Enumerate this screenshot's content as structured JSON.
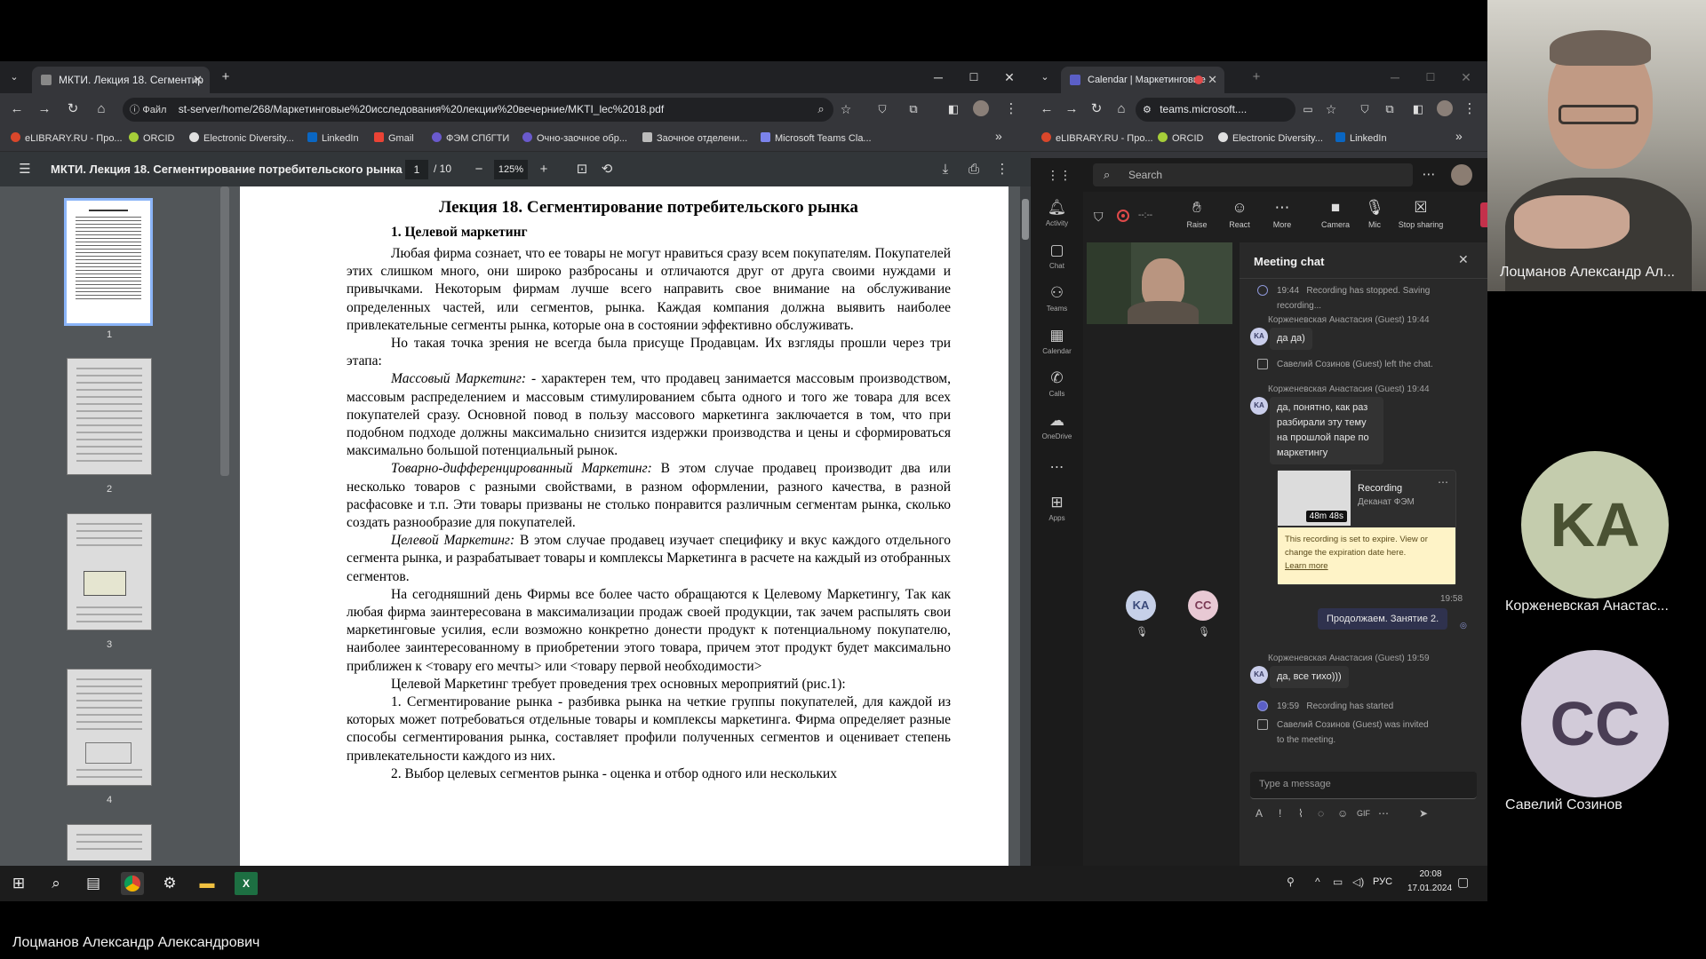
{
  "left_browser": {
    "tab_title": "МКТИ. Лекция 18. Сегментир",
    "new_tab": "+",
    "window_controls": [
      "─",
      "☐",
      "✕"
    ],
    "address_scheme": "Файл",
    "address_url": "st-server/home/268/Маркетинговые%20исследования%20лекции%20вечерние/MKTI_lec%2018.pdf",
    "bookmarks": [
      "eLIBRARY.RU - Про...",
      "ORCID",
      "Electronic Diversity...",
      "LinkedIn",
      "Gmail",
      "ФЭМ СПбГТИ",
      "Очно-заочное обр...",
      "Заочное отделени...",
      "Microsoft Teams Cla..."
    ],
    "bookmarks_more": "»"
  },
  "pdf": {
    "title": "МКТИ. Лекция 18. Сегментирование потребительского рынка",
    "page_current": "1",
    "page_total": "/ 10",
    "zoom": "125%",
    "thumbnail_numbers": [
      "1",
      "2",
      "3",
      "4"
    ],
    "heading": "Лекция 18. Сегментирование потребительского рынка",
    "subheading": "1. Целевой маркетинг",
    "p1": "Любая фирма сознает, что ее товары не могут нравиться сразу всем покупателям. Покупателей этих слишком много, они широко разбросаны и отличаются друг от друга своими нуждами и привычками. Некоторым фирмам лучше всего направить свое внимание на обслуживание определенных частей, или сегментов, рынка. Каждая компания должна выявить наиболее привлекательные сегменты рынка, которые она в состоянии эффективно обслуживать.",
    "p2": "Но такая точка зрения не всегда была присуще Продавцам. Их взгляды прошли через три этапа:",
    "p3_term": "Массовый Маркетинг:",
    "p3": " - характерен тем, что продавец занимается массовым производством, массовым распределением и массовым стимулированием сбыта одного и того же товара для всех покупателей сразу. Основной повод в пользу массового маркетинга заключается в том, что при подобном подходе должны максимально снизится издержки производства и цены и сформироваться максимально большой потенциальный рынок.",
    "p4_term": "Товарно-дифференцированный Маркетинг:",
    "p4": " В этом случае продавец производит два или несколько товаров с разными свойствами, в разном оформлении, разного качества, в разной расфасовке и т.п. Эти товары призваны не столько понравится различным сегментам рынка, сколько создать разнообразие для покупателей.",
    "p5_term": "Целевой Маркетинг:",
    "p5": " В этом случае продавец изучает специфику и вкус каждого отдельного сегмента рынка, и разрабатывает товары и комплексы Маркетинга в расчете на каждый из отобранных сегментов.",
    "p6": "На сегодняшний день Фирмы все более часто обращаются к Целевому Маркетингу, Так как любая фирма заинтересована в максимализации продаж своей продукции, так зачем распылять свои маркетинговые усилия, если возможно конкретно донести продукт к потенциальному покупателю, наиболее заинтересованному в приобретении этого товара, причем этот продукт будет максимально приближен к <товару его мечты> или <товару первой необходимости>",
    "p7": "Целевой Маркетинг требует проведения трех основных мероприятий (рис.1):",
    "p8": "1. Сегментирование рынка - разбивка рынка на четкие группы покупателей, для каждой из которых может потребоваться отдельные товары и комплексы маркетинга. Фирма определяет разные способы сегментирования рынка, составляет профили полученных сегментов и оценивает степень привлекательности каждого из них.",
    "p9": "2. Выбор целевых сегментов рынка - оценка и отбор одного или нескольких"
  },
  "right_browser": {
    "tab_title": "Calendar | Маркетинговые",
    "address_url": "teams.microsoft....",
    "bookmarks": [
      "eLIBRARY.RU - Про...",
      "ORCID",
      "Electronic Diversity...",
      "LinkedIn"
    ],
    "bookmarks_more": "»"
  },
  "teams": {
    "search_placeholder": "Search",
    "rail": [
      "Activity",
      "Chat",
      "Teams",
      "Calendar",
      "Calls",
      "OneDrive",
      "Apps"
    ],
    "timer": "--:--",
    "controls": [
      "Raise",
      "React",
      "More",
      "Camera",
      "Mic",
      "Stop sharing"
    ],
    "stage_initials": [
      "KA",
      "CC"
    ],
    "chat_title": "Meeting chat",
    "messages": {
      "sys1_time": "19:44",
      "sys1": "Recording has stopped. Saving recording...",
      "sender1": "Корженевская Анастасия (Guest)",
      "sender1_time": "19:44",
      "msg1": "да да)",
      "sys2": "Савелий Созинов (Guest) left the chat.",
      "sender2": "Корженевская Анастасия (Guest)",
      "sender2_time": "19:44",
      "msg2": "да, понятно, как раз разбирали эту тему на прошлой паре по маркетингу",
      "rec_title": "Recording",
      "rec_sub": "Деканат ФЭМ",
      "rec_duration": "48m 48s",
      "rec_notice": "This recording is set to expire. View or change the expiration date here.",
      "rec_link": "Learn more",
      "my_time": "19:58",
      "my_msg": "Продолжаем. Занятие 2.",
      "sender3": "Корженевская Анастасия (Guest)",
      "sender3_time": "19:59",
      "msg3": "да, все тихо)))",
      "sys3_time": "19:59",
      "sys3": "Recording has started",
      "sys4": "Савелий Созинов (Guest) was invited to the meeting."
    },
    "compose_placeholder": "Type a message"
  },
  "participants": [
    {
      "name": "Лоцманов Александр Ал...",
      "initials": ""
    },
    {
      "name": "Корженевская Анастас...",
      "initials": "KA",
      "color": "#c4ccad"
    },
    {
      "name": "Савелий Созинов",
      "initials": "CC",
      "color": "#d2cbd9"
    }
  ],
  "taskbar": {
    "lang": "РУС",
    "time": "20:08",
    "date": "17.01.2024"
  },
  "footer_name": "Лоцманов Александр Александрович"
}
